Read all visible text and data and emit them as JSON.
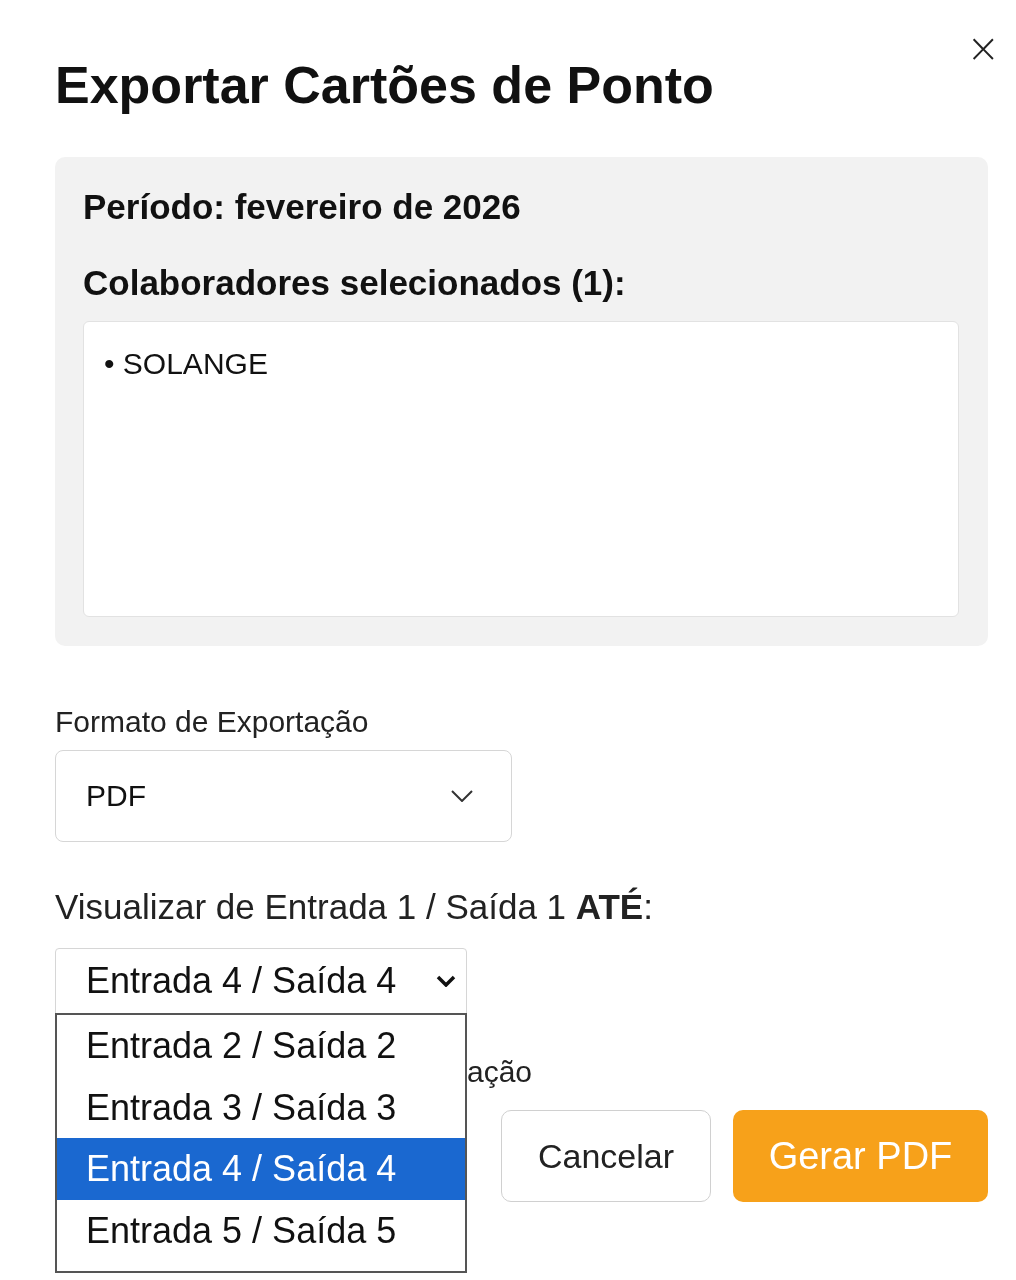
{
  "dialog": {
    "title": "Exportar Cartões de Ponto",
    "close": "×"
  },
  "summary": {
    "period": "Período: fevereiro de 2026",
    "employees_label": "Colaboradores selecionados (1):",
    "employees": [
      "• SOLANGE"
    ]
  },
  "format": {
    "label": "Formato de Exportação",
    "value": "PDF"
  },
  "range": {
    "label": "Visualizar de Entrada 1 / Saída 1 **ATÉ**:",
    "value": "Entrada 4 / Saída 4",
    "options": [
      {
        "label": "Entrada 2 / Saída 2",
        "selected": false
      },
      {
        "label": "Entrada 3 / Saída 3",
        "selected": false
      },
      {
        "label": "Entrada 4 / Saída 4",
        "selected": true
      },
      {
        "label": "Entrada 5 / Saída 5",
        "selected": false
      }
    ]
  },
  "covered_text": "ação",
  "buttons": [
    {
      "label": "Cancelar",
      "kind": "secondary"
    },
    {
      "label": "Gerar PDF",
      "kind": "primary"
    }
  ]
}
